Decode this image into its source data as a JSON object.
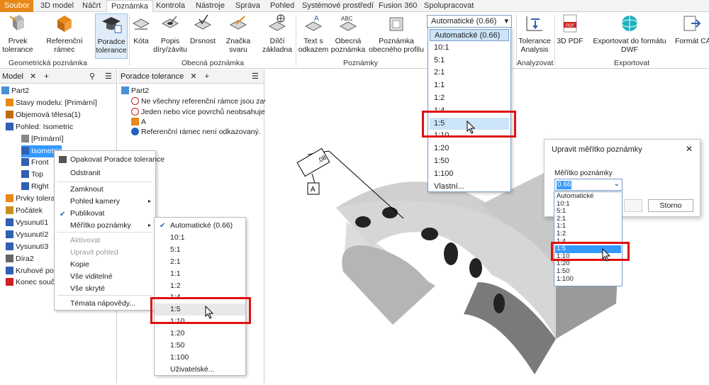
{
  "tabs": [
    "Soubor",
    "3D model",
    "Náčrt",
    "Poznámka",
    "Kontrola",
    "Nástroje",
    "Správa",
    "Pohled",
    "Systémové prostředí",
    "Fusion 360",
    "Spolupracovat"
  ],
  "ribbon": {
    "tools": {
      "prvek_tolerance": "Prvek tolerance",
      "referencni_ramec": "Referenční rámec",
      "poradce_tolerance": "Poradce tolerance",
      "kota": "Kóta",
      "popis_diry": "Popis díry/závitu",
      "drsnost": "Drsnost",
      "znacka_svaru": "Značka svaru",
      "dilci_zaklad": "Dílčí základna",
      "text_odkaz": "Text s odkazem",
      "obecna_poznamka": "Obecná poznámka",
      "poznamka_profil": "Poznámka obecného profilu",
      "tolerance_analysis": "Tolerance Analysis",
      "pdf3d": "3D PDF",
      "dwf": "Exportovat do formátu DWF",
      "format_ca": "Formát CA"
    },
    "icon_text": {
      "abc": "ABC",
      "a": "A",
      "pdf": "PDF"
    },
    "groups": {
      "geometricka": "Geometrická poznámka",
      "obecna": "Obecná poznámka",
      "poznamky": "Poznámky",
      "analyzovat": "Analyzovat",
      "exportovat": "Exportovat"
    },
    "scale_combo": "Automatické (0.66)"
  },
  "scale_dropdown": {
    "items": [
      "Automatické (0.66)",
      "10:1",
      "5:1",
      "2:1",
      "1:1",
      "1:2",
      "1:4",
      "1:5",
      "1:10",
      "1:20",
      "1:50",
      "1:100",
      "Vlastní..."
    ]
  },
  "model_panel": {
    "tab": "Model",
    "rows": [
      "Part2",
      "Stavy modelu: [Primární]",
      "Objemová tělesa(1)",
      "Pohled: Isometric",
      "[Primární]",
      "Isometric",
      "Front",
      "Top",
      "Right",
      "Prvky tolera",
      "Počátek",
      "Vysunutí1",
      "Vysunutí2",
      "Vysunutí3",
      "Díra2",
      "Kruhové po",
      "Konec souč"
    ]
  },
  "advisor_panel": {
    "tab": "Poradce tolerance",
    "rows": [
      "Part2",
      "Ne všechny referenční rámce jsou zavazt",
      "Jeden nebo více povrchů neobsahuje vaz",
      "A",
      "Referenční rámec není odkazovaný."
    ]
  },
  "context_menu": {
    "items": [
      "Opakovat Poradce tolerance",
      "Odstranit",
      "Zamknout",
      "Pohled kamery",
      "Publikovat",
      "Měřítko poznámky",
      "Aktivovat",
      "Upravit pohled",
      "Kopie",
      "Vše viditelné",
      "Vše skryté",
      "Témata nápovědy..."
    ]
  },
  "submenu": {
    "items": [
      "Automatické (0.66)",
      "10:1",
      "5:1",
      "2:1",
      "1:1",
      "1:2",
      "1:4",
      "1:5",
      "1:10",
      "1:20",
      "1:50",
      "1:100",
      "Uživatelské..."
    ]
  },
  "dialog": {
    "title": "Upravit měřítko poznámky",
    "label": "Měřítko poznámky",
    "value": "0.66",
    "cancel": "Storno",
    "list": [
      "Automatické",
      "10:1",
      "5:1",
      "2:1",
      "1:1",
      "1:2",
      "1:4",
      "1:5",
      "1:10",
      "1:20",
      "1:50",
      "1:100"
    ]
  },
  "annotation": {
    "frame_value": ".08",
    "datum": "A"
  },
  "colors": {
    "accent": "#e8871a",
    "highlight": "#3399ff",
    "redbox": "#e01010",
    "selection": "#cce4f7"
  }
}
